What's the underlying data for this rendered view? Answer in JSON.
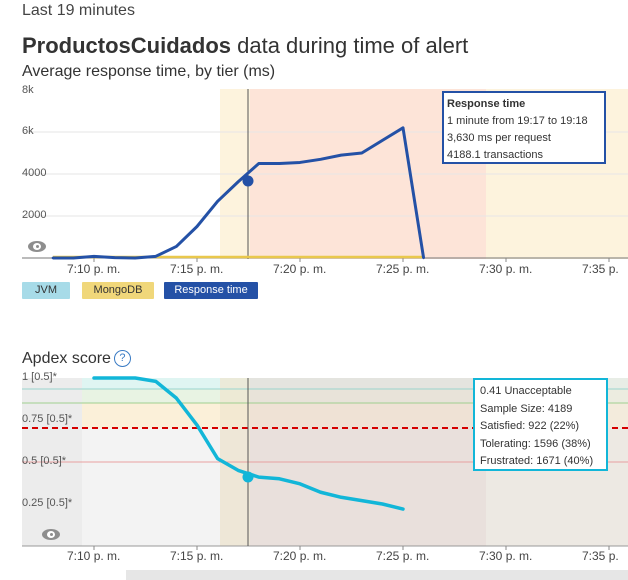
{
  "header": {
    "time_range": "Last 19 minutes",
    "title_app": "ProductosCuidados",
    "title_rest": " data during time of alert"
  },
  "response_chart": {
    "subtitle": "Average response time, by tier (ms)",
    "y_ticks": [
      "8k",
      "6k",
      "4000",
      "2000"
    ],
    "x_ticks": [
      "7:10 p. m.",
      "7:15 p. m.",
      "7:20 p. m.",
      "7:25 p. m.",
      "7:30 p. m.",
      "7:35 p."
    ],
    "legend": [
      {
        "label": "JVM",
        "color": "#a7dbe8"
      },
      {
        "label": "MongoDB",
        "color": "#f0d77a"
      },
      {
        "label": "Response time",
        "color": "#2451a6"
      }
    ],
    "tooltip": {
      "title": "Response time",
      "line1": "1 minute from 19:17 to 19:18",
      "line2": "3,630 ms per request",
      "line3": "4188.1 transactions"
    }
  },
  "apdex_chart": {
    "title": "Apdex score",
    "help_glyph": "?",
    "y_ticks": [
      "1 [0.5]*",
      "0.75 [0.5]*",
      "0.5 [0.5]*",
      "0.25 [0.5]*"
    ],
    "x_ticks": [
      "7:10 p. m.",
      "7:15 p. m.",
      "7:20 p. m.",
      "7:25 p. m.",
      "7:30 p. m.",
      "7:35 p."
    ],
    "tooltip": {
      "line1": "0.41 Unacceptable",
      "line2": "Sample Size: 4189",
      "line3": "Satisfied: 922 (22%)",
      "line4": "Tolerating: 1596 (38%)",
      "line5": "Frustrated: 1671 (40%)"
    }
  },
  "chart_data": [
    {
      "type": "line",
      "title": "Average response time, by tier (ms)",
      "ylim": [
        0,
        8000
      ],
      "series": [
        {
          "name": "Response time",
          "color": "#2451a6",
          "x": [
            "19:08",
            "19:09",
            "19:10",
            "19:11",
            "19:12",
            "19:13",
            "19:14",
            "19:15",
            "19:16",
            "19:17",
            "19:18",
            "19:19",
            "19:20",
            "19:21",
            "19:22",
            "19:23",
            "19:24",
            "19:25",
            "19:26"
          ],
          "values": [
            0,
            0,
            80,
            20,
            0,
            80,
            550,
            1500,
            2700,
            3630,
            4500,
            4500,
            4550,
            4700,
            4900,
            5000,
            5600,
            6200,
            0
          ]
        },
        {
          "name": "MongoDB",
          "color": "#f0d77a",
          "x": [
            "19:08",
            "19:26"
          ],
          "values": [
            50,
            50
          ]
        }
      ]
    },
    {
      "type": "line",
      "title": "Apdex score",
      "ylim": [
        0,
        1.1
      ],
      "series": [
        {
          "color": "#12b6d8",
          "x": [
            "19:10",
            "19:11",
            "19:12",
            "19:13",
            "19:14",
            "19:15",
            "19:16",
            "19:17",
            "19:18",
            "19:19",
            "19:20",
            "19:21",
            "19:22",
            "19:23",
            "19:24",
            "19:25"
          ],
          "values": [
            1.0,
            1.0,
            1.0,
            0.98,
            0.88,
            0.72,
            0.52,
            0.45,
            0.41,
            0.4,
            0.37,
            0.32,
            0.29,
            0.27,
            0.25,
            0.22
          ]
        }
      ]
    }
  ]
}
